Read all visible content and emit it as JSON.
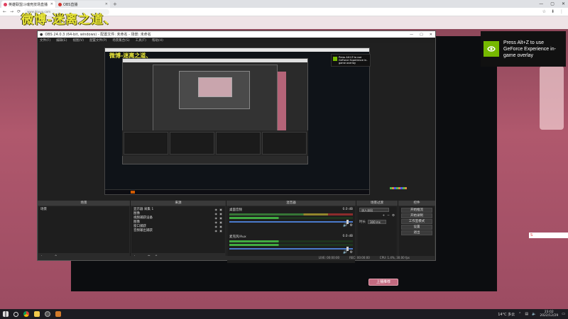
{
  "browser": {
    "tabs": [
      {
        "title": "英雄联盟斗魂竞技场直播",
        "favicon_color": "#e04060",
        "active": true
      },
      {
        "title": "OBS直播",
        "favicon_color": "#d0352e",
        "active": false
      }
    ],
    "new_tab": "+",
    "window_controls": [
      "—",
      "▢",
      "✕"
    ],
    "nav_icons": [
      "←",
      "→",
      "⟳"
    ],
    "address": "www.douyu.com",
    "addr_icons": [
      "☆",
      "⬇",
      "⋮"
    ]
  },
  "overlay_title": "微博-迷离之道、",
  "geforce_toast": {
    "text": "Press Alt+Z to use GeForce Experience in-game overlay"
  },
  "page": {
    "button_label": "上播推荐",
    "chat_bar_icon": "S"
  },
  "obs": {
    "title": "OBS 24.0.3 (64-bit, windows) - 配置文件: 未命名 - 场景: 未命名",
    "window_controls": [
      "—",
      "▢",
      "✕"
    ],
    "menu": [
      "文件(F)",
      "编辑(E)",
      "视图(V)",
      "配置文件(P)",
      "场景集合(S)",
      "工具(T)",
      "帮助(H)"
    ],
    "preview": {
      "mini_title": "微博-迷离之道、",
      "mini_title2": "微博-迷离之道、",
      "mini_toast": "Press Alt+Z to use GeForce Experience in-game overlay"
    },
    "docks": {
      "scenes": {
        "header": "场景",
        "items": [
          "场景"
        ]
      },
      "sources": {
        "header": "来源",
        "items": [
          "显示器 采集 1",
          "图像",
          "视频捕获设备",
          "图像",
          "窗口捕获",
          "音频输出捕获"
        ]
      },
      "mixer": {
        "header": "混音器",
        "channels": [
          {
            "name": "桌面音频",
            "level": "0.0 dB"
          },
          {
            "name": "麦克风/Aux",
            "level": "0.0 dB"
          }
        ]
      },
      "transitions": {
        "header": "场景过渡",
        "type_value": "淡入淡出",
        "duration_label": "时长",
        "duration_value": "300 ms"
      },
      "controls": {
        "header": "控件",
        "buttons": [
          "开始推流",
          "开始录制",
          "工作室模式",
          "设置",
          "退出"
        ]
      }
    },
    "statusbar": {
      "live": "LIVE: 00:00:00",
      "rec": "REC: 00:00:00",
      "cpu": "CPU: 1.4%, 30.00 fps"
    }
  },
  "taskbar": {
    "icons": [
      {
        "name": "windows-start-icon",
        "color": "#ddd"
      },
      {
        "name": "search-icon",
        "color": "#ddd"
      },
      {
        "name": "chrome-icon",
        "color": "#e7b521"
      },
      {
        "name": "file-explorer-icon",
        "color": "#f2c94c"
      },
      {
        "name": "obs-icon",
        "color": "#888"
      },
      {
        "name": "app-icon",
        "color": "#d27a2a"
      }
    ],
    "weather": "14°C 多云",
    "time": "23:02",
    "date": "2022/12/29"
  }
}
